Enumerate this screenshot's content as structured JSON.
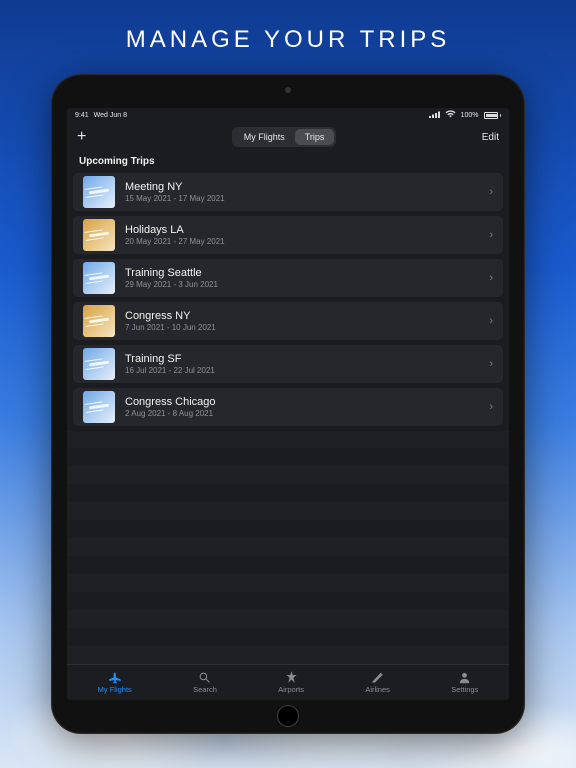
{
  "hero": "MANAGE YOUR TRIPS",
  "status": {
    "time": "9:41",
    "date": "Wed Jun 8",
    "battery_pct": "100%"
  },
  "navbar": {
    "add_label": "+",
    "edit_label": "Edit",
    "segments": {
      "my_flights": "My Flights",
      "trips": "Trips",
      "active": "trips"
    }
  },
  "section_title": "Upcoming Trips",
  "trips": [
    {
      "title": "Meeting NY",
      "dates": "15 May 2021 - 17 May 2021",
      "thumb": "cool"
    },
    {
      "title": "Holidays LA",
      "dates": "20 May 2021 - 27 May 2021",
      "thumb": "warm"
    },
    {
      "title": "Training Seattle",
      "dates": "29 May 2021 - 3 Jun 2021",
      "thumb": "cool"
    },
    {
      "title": "Congress NY",
      "dates": "7 Jun 2021 - 10 Jun 2021",
      "thumb": "warm"
    },
    {
      "title": "Training SF",
      "dates": "16 Jul 2021 - 22 Jul 2021",
      "thumb": "cool"
    },
    {
      "title": "Congress Chicago",
      "dates": "2 Aug 2021 - 8 Aug 2021",
      "thumb": "cool"
    }
  ],
  "tabs": {
    "my_flights": "My Flights",
    "search": "Search",
    "airports": "Airports",
    "airlines": "Airlines",
    "settings": "Settings",
    "active": "my_flights"
  }
}
